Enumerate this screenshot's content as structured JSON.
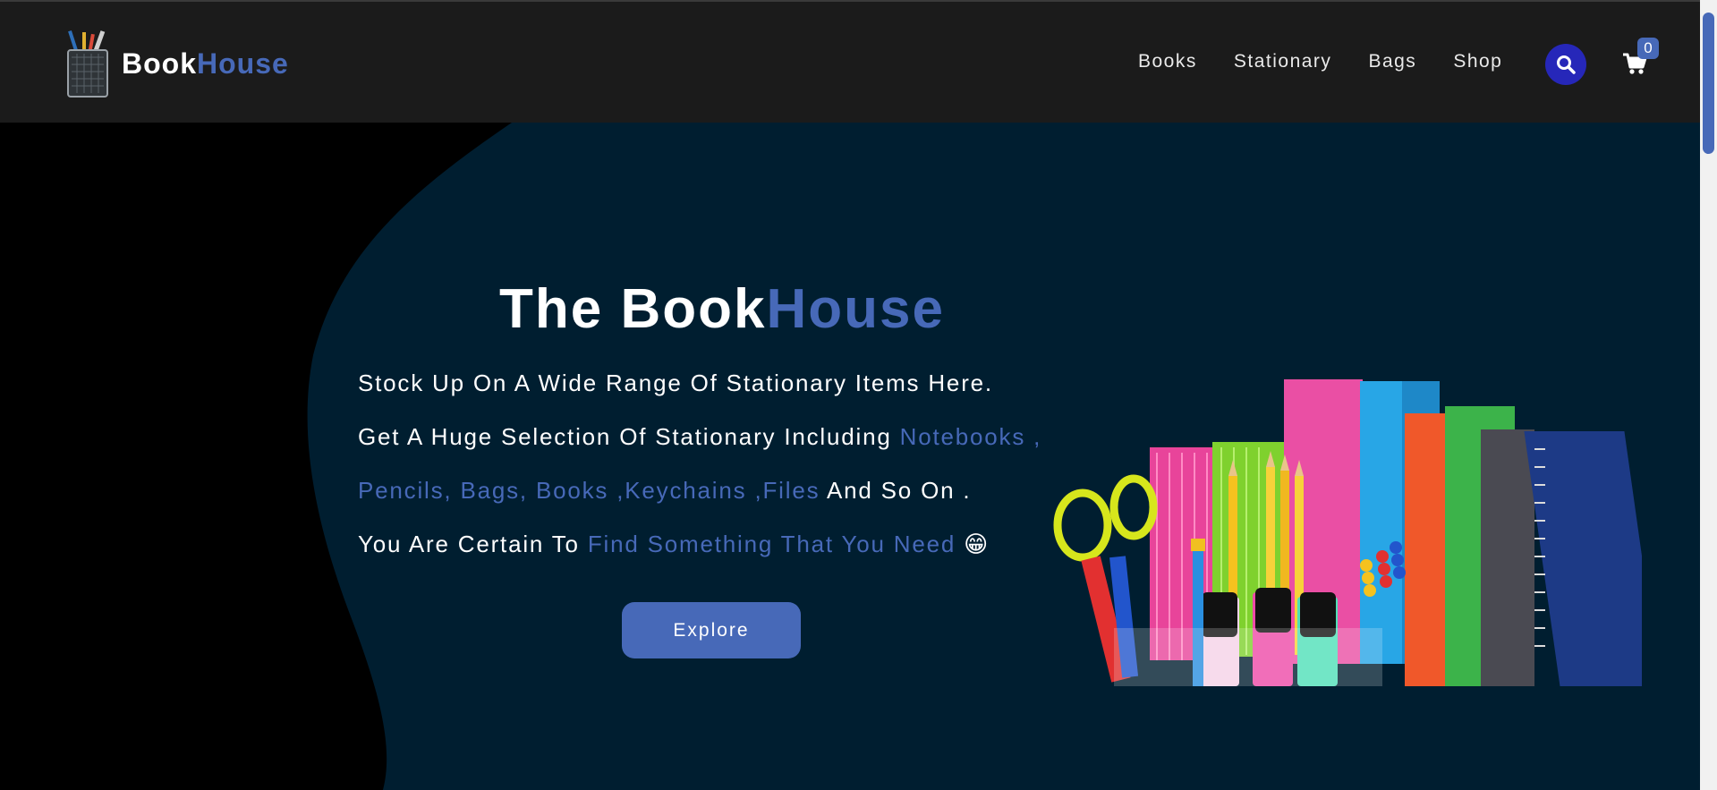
{
  "brand": {
    "name_part1": "Book",
    "name_part2": "House"
  },
  "nav": {
    "items": [
      "Books",
      "Stationary",
      "Bags",
      "Shop"
    ]
  },
  "cart": {
    "count": "0"
  },
  "hero": {
    "title_part1": "The Book",
    "title_part2": "House",
    "line1": "Stock Up On A Wide Range Of Stationary Items Here.",
    "line2_a": "Get A Huge Selection Of Stationary Including ",
    "line2_b": "Notebooks ,",
    "line3_a": "Pencils, Bags, Books ,Keychains ,Files",
    "line3_b": " And So On .",
    "line4_a": "You Are Certain To ",
    "line4_b": "Find Something That You Need",
    "line4_c": " 😁",
    "explore_label": "Explore"
  },
  "colors": {
    "accent": "#4769b8",
    "navbar_bg": "#1b1b1b",
    "hero_panel": "#001e30",
    "search_button": "#2627b9"
  },
  "icons": {
    "logo": "pencil-cup-icon",
    "search": "search-icon",
    "cart": "cart-icon"
  }
}
